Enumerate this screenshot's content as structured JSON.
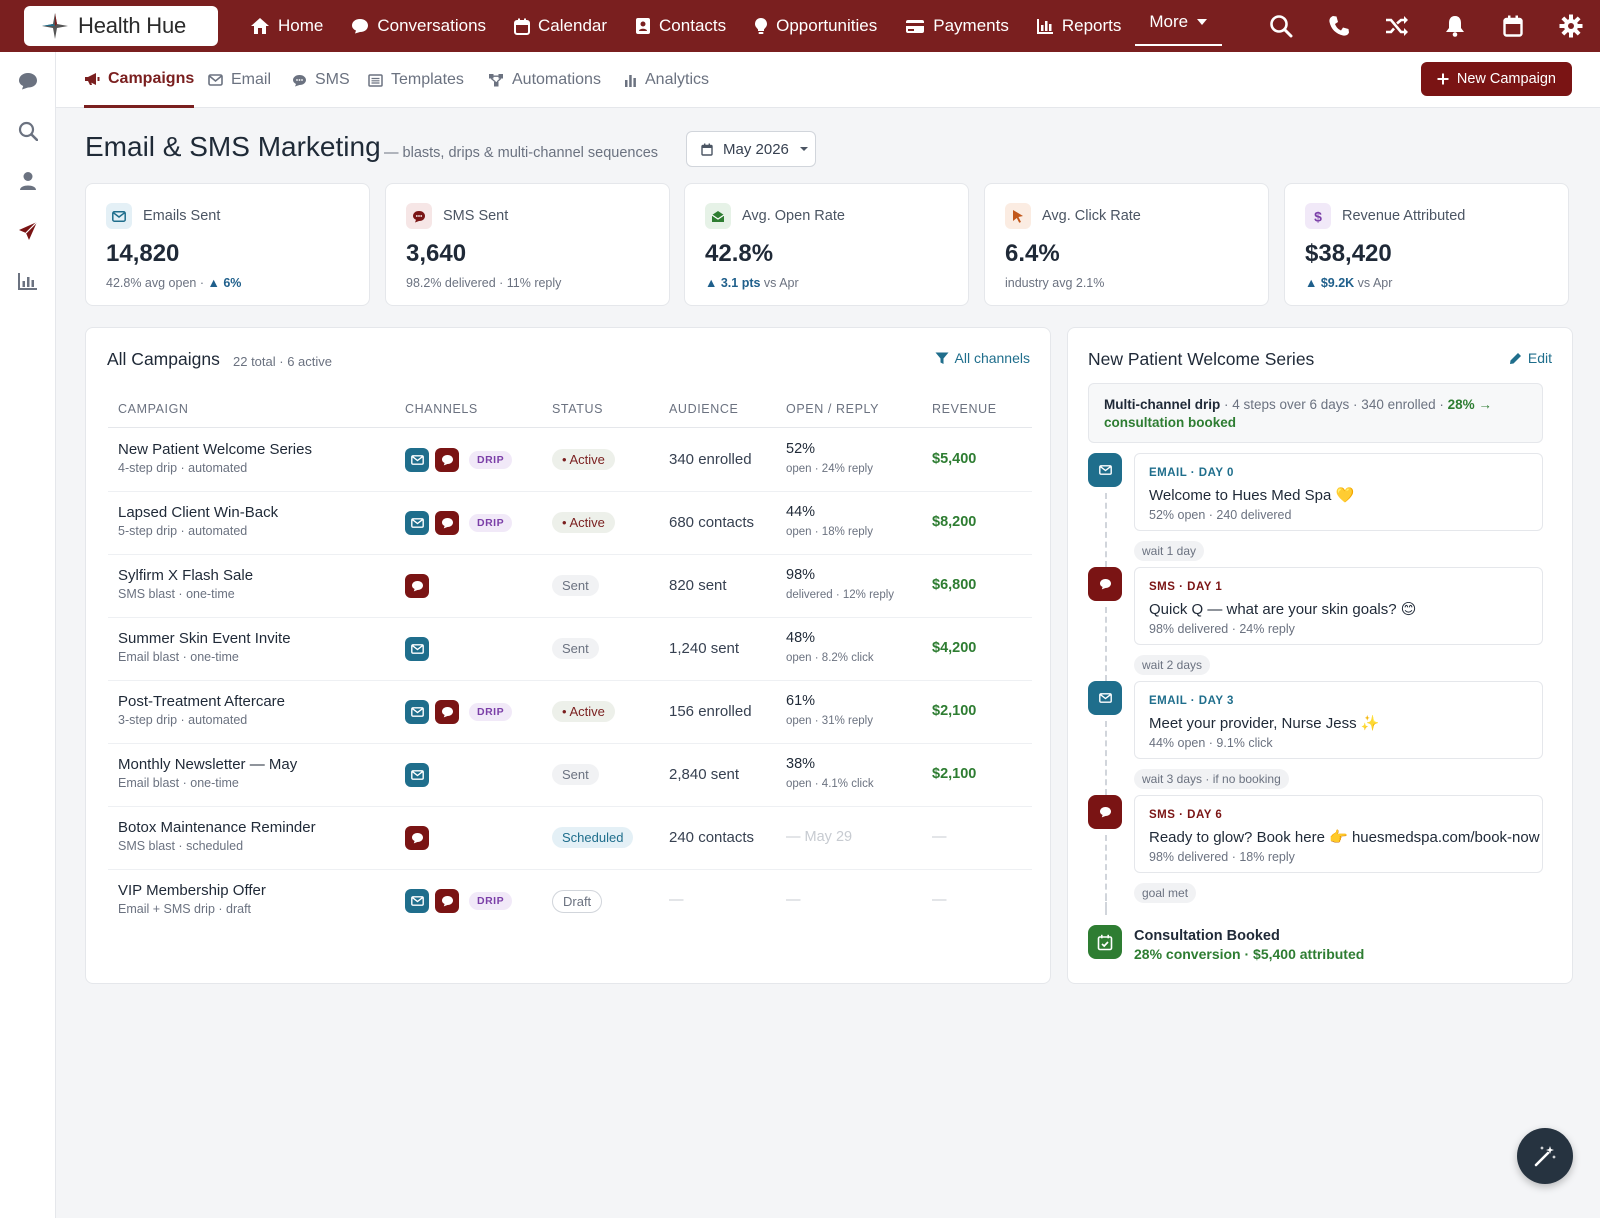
{
  "app": {
    "name": "Health Hue"
  },
  "topnav": {
    "items": [
      {
        "label": "Home",
        "icon": "home-icon"
      },
      {
        "label": "Conversations",
        "icon": "chat-icon"
      },
      {
        "label": "Calendar",
        "icon": "calendar-icon"
      },
      {
        "label": "Contacts",
        "icon": "contacts-icon"
      },
      {
        "label": "Opportunities",
        "icon": "lightbulb-icon"
      },
      {
        "label": "Payments",
        "icon": "credit-card-icon"
      },
      {
        "label": "Reports",
        "icon": "bar-chart-icon"
      },
      {
        "label": "More",
        "icon": "caret-down-icon"
      }
    ],
    "right_icons": [
      "search-icon",
      "phone-icon",
      "shuffle-icon",
      "bell-icon",
      "calendar-icon",
      "gear-icon"
    ]
  },
  "rail": {
    "icons": [
      "chat-icon",
      "search-icon",
      "user-icon",
      "paper-plane-icon",
      "bar-chart-icon"
    ]
  },
  "subtabs": {
    "items": [
      {
        "label": "Campaigns",
        "icon": "megaphone-icon",
        "active": true
      },
      {
        "label": "Email",
        "icon": "envelope-icon"
      },
      {
        "label": "SMS",
        "icon": "sms-icon"
      },
      {
        "label": "Templates",
        "icon": "list-icon"
      },
      {
        "label": "Automations",
        "icon": "automation-icon"
      },
      {
        "label": "Analytics",
        "icon": "bar-chart-icon"
      }
    ],
    "new_campaign": "New Campaign"
  },
  "header": {
    "title": "Email & SMS Marketing",
    "subtitle": "— blasts, drips & multi-channel sequences",
    "month": "May 2026"
  },
  "kpis": [
    {
      "label": "Emails Sent",
      "value": "14,820",
      "sub_a": "42.8% avg open · ",
      "sub_up": "▲ 6%",
      "sub_b": "",
      "icon": "envelope-icon",
      "color": "#1f6e8c",
      "bg": "#e4f0f6"
    },
    {
      "label": "SMS Sent",
      "value": "3,640",
      "sub_a": "98.2% delivered · 11% reply",
      "sub_up": "",
      "sub_b": "",
      "icon": "sms-icon",
      "color": "#7a1414",
      "bg": "#f6e6e6"
    },
    {
      "label": "Avg. Open Rate",
      "value": "42.8%",
      "sub_a": "",
      "sub_up": "▲ 3.1 pts",
      "sub_b": " vs Apr",
      "icon": "mail-open-icon",
      "color": "#2e7d32",
      "bg": "#e6f2e7"
    },
    {
      "label": "Avg. Click Rate",
      "value": "6.4%",
      "sub_a": "industry avg 2.1%",
      "sub_up": "",
      "sub_b": "",
      "icon": "pointer-icon",
      "color": "#c2571a",
      "bg": "#fbece2"
    },
    {
      "label": "Revenue Attributed",
      "value": "$38,420",
      "sub_a": "",
      "sub_up": "▲ $9.2K",
      "sub_b": " vs Apr",
      "icon": "dollar-icon",
      "color": "#7b3fa8",
      "bg": "#f1e9f8"
    }
  ],
  "campaigns": {
    "title": "All Campaigns",
    "meta": "22 total · 6 active",
    "filter": "All channels",
    "columns": [
      "CAMPAIGN",
      "CHANNELS",
      "STATUS",
      "AUDIENCE",
      "OPEN / REPLY",
      "REVENUE"
    ],
    "rows": [
      {
        "name": "New Patient Welcome Series",
        "desc": "4-step drip · automated",
        "email": true,
        "sms": true,
        "drip": "DRIP",
        "status": "Active",
        "status_type": "active",
        "audience": "340 enrolled",
        "open": "52%",
        "open_sub": "open · 24% reply",
        "revenue": "$5,400"
      },
      {
        "name": "Lapsed Client Win-Back",
        "desc": "5-step drip · automated",
        "email": true,
        "sms": true,
        "drip": "DRIP",
        "status": "Active",
        "status_type": "active",
        "audience": "680 contacts",
        "open": "44%",
        "open_sub": "open · 18% reply",
        "revenue": "$8,200"
      },
      {
        "name": "Sylfirm X Flash Sale",
        "desc": "SMS blast · one-time",
        "email": false,
        "sms": true,
        "drip": "",
        "status": "Sent",
        "status_type": "sent",
        "audience": "820 sent",
        "open": "98%",
        "open_sub": "delivered · 12% reply",
        "revenue": "$6,800"
      },
      {
        "name": "Summer Skin Event Invite",
        "desc": "Email blast · one-time",
        "email": true,
        "sms": false,
        "drip": "",
        "status": "Sent",
        "status_type": "sent",
        "audience": "1,240 sent",
        "open": "48%",
        "open_sub": "open · 8.2% click",
        "revenue": "$4,200"
      },
      {
        "name": "Post-Treatment Aftercare",
        "desc": "3-step drip · automated",
        "email": true,
        "sms": true,
        "drip": "DRIP",
        "status": "Active",
        "status_type": "active",
        "audience": "156 enrolled",
        "open": "61%",
        "open_sub": "open · 31% reply",
        "revenue": "$2,100"
      },
      {
        "name": "Monthly Newsletter — May",
        "desc": "Email blast · one-time",
        "email": true,
        "sms": false,
        "drip": "",
        "status": "Sent",
        "status_type": "sent",
        "audience": "2,840 sent",
        "open": "38%",
        "open_sub": "open · 4.1% click",
        "revenue": "$2,100"
      },
      {
        "name": "Botox Maintenance Reminder",
        "desc": "SMS blast · scheduled",
        "email": false,
        "sms": true,
        "drip": "",
        "status": "Scheduled",
        "status_type": "sched",
        "audience": "240 contacts",
        "open": "",
        "open_muted": "— May 29",
        "open_sub": "",
        "revenue": "",
        "revenue_muted": "—"
      },
      {
        "name": "VIP Membership Offer",
        "desc": "Email + SMS drip · draft",
        "email": true,
        "sms": true,
        "drip": "DRIP",
        "status": "Draft",
        "status_type": "draft",
        "audience": "",
        "audience_muted": "—",
        "open": "",
        "open_muted": "—",
        "open_sub": "",
        "revenue": "",
        "revenue_muted": "—"
      }
    ]
  },
  "sequence": {
    "title": "New Patient Welcome Series",
    "edit": "Edit",
    "summary_bold": "Multi-channel drip",
    "summary_text": " · 4 steps over 6 days · 340 enrolled · ",
    "summary_green": "28% → consultation booked",
    "steps": [
      {
        "channel": "email",
        "label": "EMAIL · DAY 0",
        "title": "Welcome to Hues Med Spa 💛",
        "stats": "52% open · 240 delivered",
        "wait": "wait 1 day"
      },
      {
        "channel": "sms",
        "label": "SMS · DAY 1",
        "title": "Quick Q — what are your skin goals? 😊",
        "stats": "98% delivered · 24% reply",
        "wait": "wait 2 days"
      },
      {
        "channel": "email",
        "label": "EMAIL · DAY 3",
        "title": "Meet your provider, Nurse Jess ✨",
        "stats": "44% open · 9.1% click",
        "wait": "wait 3 days · if no booking"
      },
      {
        "channel": "sms",
        "label": "SMS · DAY 6",
        "title": "Ready to glow? Book here 👉 huesmedspa.com/book-now",
        "stats": "98% delivered · 18% reply",
        "wait": "goal met"
      }
    ],
    "goal_title": "Consultation Booked",
    "goal_sub": "28% conversion · $5,400 attributed"
  },
  "colors": {
    "brand": "#7a1f1f",
    "email": "#1f6e8c",
    "sms": "#7a1414",
    "positive": "#2e7d32"
  }
}
